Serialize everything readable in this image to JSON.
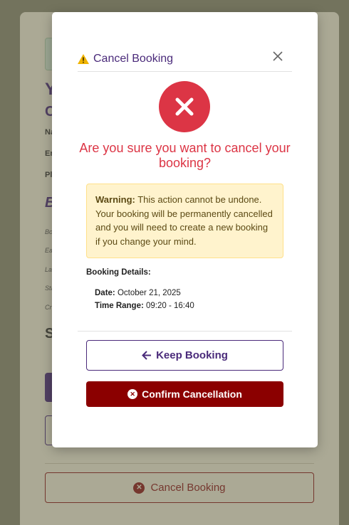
{
  "background": {
    "cancel_button_label": "Cancel Booking"
  },
  "modal": {
    "title": "Cancel Booking",
    "question": "Are you sure you want to cancel your booking?",
    "warning": {
      "label": "Warning:",
      "text": " This action cannot be undone. Your booking will be permanently cancelled and you will need to create a new booking if you change your mind."
    },
    "details_label": "Booking Details:",
    "date_label": "Date:",
    "date_value": " October 21, 2025",
    "time_label": "Time Range:",
    "time_value": " 09:20 - 16:40",
    "keep_label": "Keep Booking",
    "confirm_label": "Confirm Cancellation"
  },
  "icons": {
    "warning": "warning-triangle-icon",
    "close": "close-icon",
    "error": "x-circle-icon",
    "back": "arrow-left-icon"
  },
  "colors": {
    "accent": "#4a2a7a",
    "danger": "#dc3545",
    "danger_dark": "#8b0000",
    "warning_bg": "#fff3cd"
  }
}
